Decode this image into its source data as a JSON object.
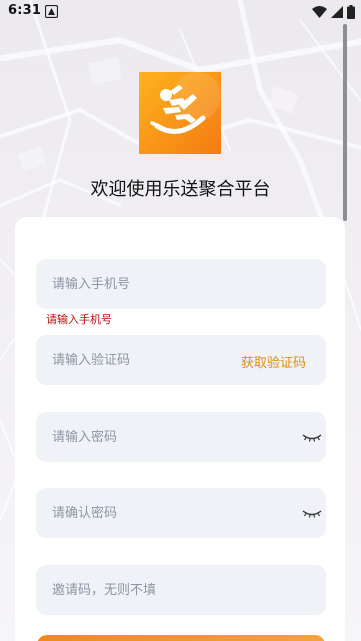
{
  "status_bar": {
    "time": "6:31",
    "icons": [
      "notification-icon",
      "wifi-icon",
      "signal-icon",
      "battery-icon"
    ]
  },
  "app": {
    "logo_icon": "runner-logo-icon",
    "welcome_title": "欢迎使用乐送聚合平台",
    "brand_colors": {
      "accent": "#e28f12",
      "logo_gradient_start": "#ffb21f",
      "logo_gradient_end": "#f37c12",
      "error": "#c20e0e",
      "field_bg": "#eff2f6"
    }
  },
  "form": {
    "phone": {
      "placeholder": "请输入手机号",
      "value": "",
      "error": "请输入手机号"
    },
    "code": {
      "placeholder": "请输入验证码",
      "value": "",
      "action_label": "获取验证码"
    },
    "password": {
      "placeholder": "请输入密码",
      "value": "",
      "toggle_icon": "eye-closed-icon"
    },
    "confirm_password": {
      "placeholder": "请确认密码",
      "value": "",
      "toggle_icon": "eye-closed-icon"
    },
    "invite": {
      "placeholder": "邀请码，无则不填",
      "value": ""
    }
  }
}
